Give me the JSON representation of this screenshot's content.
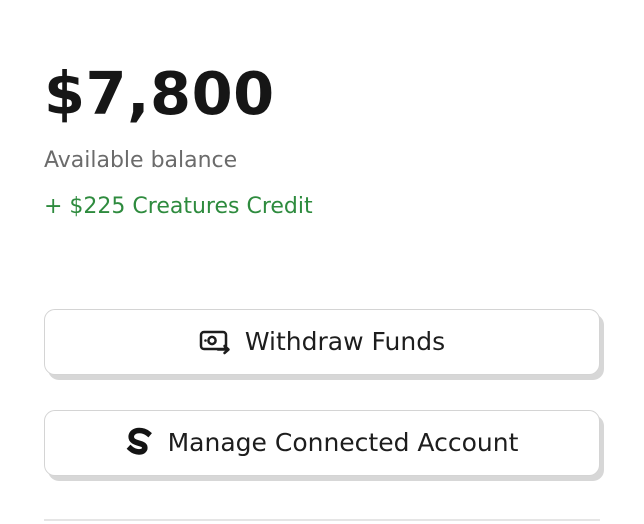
{
  "balance": {
    "amount": "$7,800",
    "label": "Available balance",
    "credit": "+ $225 Creatures Credit"
  },
  "actions": {
    "withdraw": {
      "label": "Withdraw Funds",
      "icon": "cash-transfer-icon"
    },
    "manage": {
      "label": "Manage Connected Account",
      "icon": "stripe-s-icon"
    }
  },
  "colors": {
    "credit_green": "#2e8b3e",
    "muted_text": "#6b6b6b",
    "button_border": "#d4d4d4"
  }
}
